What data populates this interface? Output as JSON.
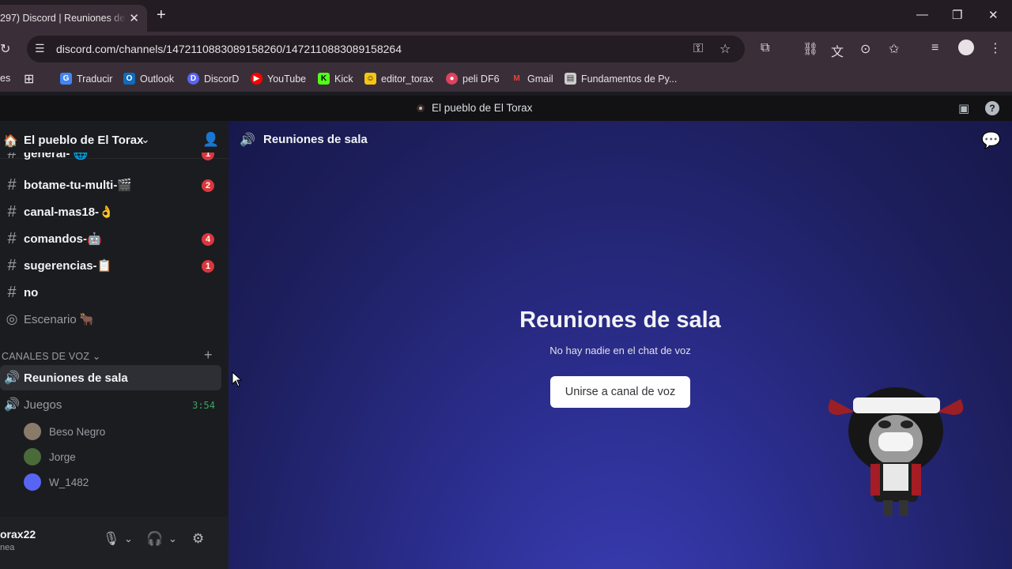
{
  "browser": {
    "tab_title": "297) Discord | Reuniones de s",
    "url": "discord.com/channels/1472110883089158260/1472110883089158264",
    "bookmarks_partial": "es",
    "bookmarks": [
      {
        "label": "Traducir",
        "color": "#4285f4"
      },
      {
        "label": "Outlook",
        "color": "#0f6cbd"
      },
      {
        "label": "DiscorD",
        "color": "#5865f2"
      },
      {
        "label": "YouTube",
        "color": "#ff0000"
      },
      {
        "label": "Kick",
        "color": "#53fc18"
      },
      {
        "label": "editor_torax",
        "color": "#f5c518"
      },
      {
        "label": "peli DF6",
        "color": "#e0415e"
      },
      {
        "label": "Gmail",
        "color": "#ea4335"
      },
      {
        "label": "Fundamentos de Py...",
        "color": "#cccccc"
      }
    ]
  },
  "discord": {
    "window_title": "El pueblo de El Torax",
    "server_name": "El pueblo de El Torax",
    "channels": [
      {
        "name": "general-",
        "emoji": "🌐",
        "badge": "1"
      },
      {
        "name": "botame-tu-multi-",
        "emoji": "🎬",
        "badge": "2"
      },
      {
        "name": "canal-mas18-",
        "emoji": "👌",
        "badge": ""
      },
      {
        "name": "comandos-",
        "emoji": "🤖",
        "badge": "4"
      },
      {
        "name": "sugerencias-",
        "emoji": "📋",
        "badge": "1"
      },
      {
        "name": "no",
        "emoji": "",
        "badge": ""
      },
      {
        "name": "Escenario",
        "emoji": "🐂",
        "badge": ""
      }
    ],
    "voice_section": "CANALES DE VOZ",
    "voice_channels": [
      {
        "name": "Reuniones de sala",
        "timer": ""
      },
      {
        "name": "Juegos",
        "timer": "3:54"
      }
    ],
    "voice_members": [
      {
        "name": "Beso Negro",
        "color": "#8a7a6a"
      },
      {
        "name": "Jorge",
        "color": "#4a6a3a"
      },
      {
        "name": "W_1482",
        "color": "#5865f2"
      }
    ],
    "user": {
      "name": "orax22",
      "status": "nea"
    },
    "main": {
      "channel_title": "Reuniones de sala",
      "heading": "Reuniones de sala",
      "subtitle": "No hay nadie en el chat de voz",
      "join_button": "Unirse a canal de voz"
    }
  }
}
